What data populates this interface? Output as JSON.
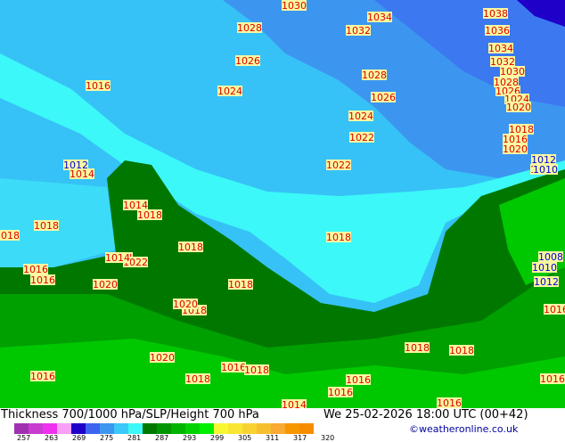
{
  "title": "Thickness 700/1000 hPa/SLP/Height 700 hPa",
  "datetime": "We 25-02-2026 18:00 UTC (00+42)",
  "credit": "©weatheronline.co.uk",
  "legend": {
    "colors": [
      "#a030b0",
      "#c83cd0",
      "#f030f0",
      "#f8a0f8",
      "#1e00c8",
      "#3c64f0",
      "#3c96f0",
      "#3cc8f8",
      "#3cf8f8",
      "#007800",
      "#009600",
      "#00b400",
      "#00d200",
      "#00f000",
      "#f8f832",
      "#f8e632",
      "#f8d232",
      "#f8be32",
      "#f8aa32",
      "#f89600",
      "#f88c00"
    ],
    "ticks": [
      "257",
      "263",
      "269",
      "275",
      "281",
      "287",
      "293",
      "299",
      "305",
      "311",
      "317",
      "320"
    ]
  },
  "isobar_labels": [
    "1030",
    "1034",
    "1038",
    "1028",
    "1032",
    "1036",
    "1026",
    "1034",
    "1032",
    "1016",
    "1024",
    "1028",
    "1030",
    "1028",
    "1026",
    "1026",
    "1024",
    "1024",
    "1022",
    "1020",
    "1022",
    "1018",
    "1016",
    "1012",
    "1014",
    "1014",
    "1020",
    "1012",
    "1014",
    "1018",
    "1010",
    "1018",
    "1018",
    "1018",
    "1018",
    "1014",
    "1016",
    "1016",
    "1022",
    "1014",
    "1020",
    "1018",
    "1008",
    "1010",
    "1012",
    "1020",
    "1018",
    "1016",
    "1018",
    "1018",
    "1020",
    "1018",
    "1016",
    "1018",
    "1016",
    "1016",
    "1016",
    "1016",
    "1014",
    "1016"
  ]
}
